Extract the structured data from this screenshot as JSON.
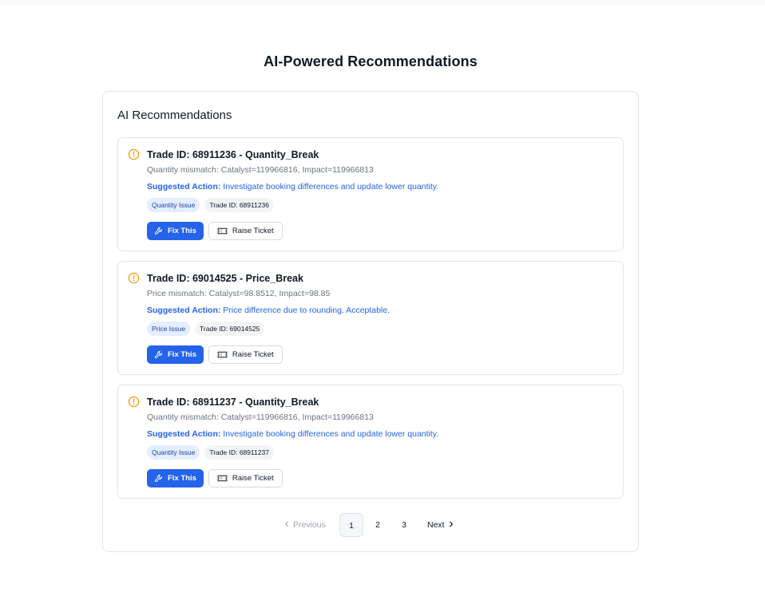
{
  "page": {
    "title": "AI-Powered Recommendations"
  },
  "panel": {
    "title": "AI Recommendations"
  },
  "recommendations": [
    {
      "title": "Trade ID: 68911236 - Quantity_Break",
      "description": "Quantity mismatch: Catalyst=119966816, Impact=119966813",
      "action_label": "Suggested Action:",
      "action_text": "Investigate booking differences and update lower quantity.",
      "tag_type": "Quantity Issue",
      "tag_id": "Trade ID: 68911236",
      "fix_label": "Fix This",
      "ticket_label": "Raise Ticket"
    },
    {
      "title": "Trade ID: 69014525 - Price_Break",
      "description": "Price mismatch: Catalyst=98.8512, Impact=98.85",
      "action_label": "Suggested Action:",
      "action_text": "Price difference due to rounding. Acceptable.",
      "tag_type": "Price Issue",
      "tag_id": "Trade ID: 69014525",
      "fix_label": "Fix This",
      "ticket_label": "Raise Ticket"
    },
    {
      "title": "Trade ID: 68911237 - Quantity_Break",
      "description": "Quantity mismatch: Catalyst=119966816, Impact=119966813",
      "action_label": "Suggested Action:",
      "action_text": "Investigate booking differences and update lower quantity.",
      "tag_type": "Quantity Issue",
      "tag_id": "Trade ID: 68911237",
      "fix_label": "Fix This",
      "ticket_label": "Raise Ticket"
    }
  ],
  "pagination": {
    "previous": "Previous",
    "pages": [
      "1",
      "2",
      "3"
    ],
    "current": "1",
    "next": "Next"
  },
  "icons": {
    "warning": "alert-circle-icon",
    "fix": "wrench-icon",
    "ticket": "ticket-icon",
    "prev": "chevron-left-icon",
    "next": "chevron-right-icon"
  },
  "colors": {
    "primary": "#2563eb",
    "warning": "#f59e0b",
    "tag_type_bg": "#e4eefc",
    "tag_id_bg": "#f3f4f6"
  }
}
